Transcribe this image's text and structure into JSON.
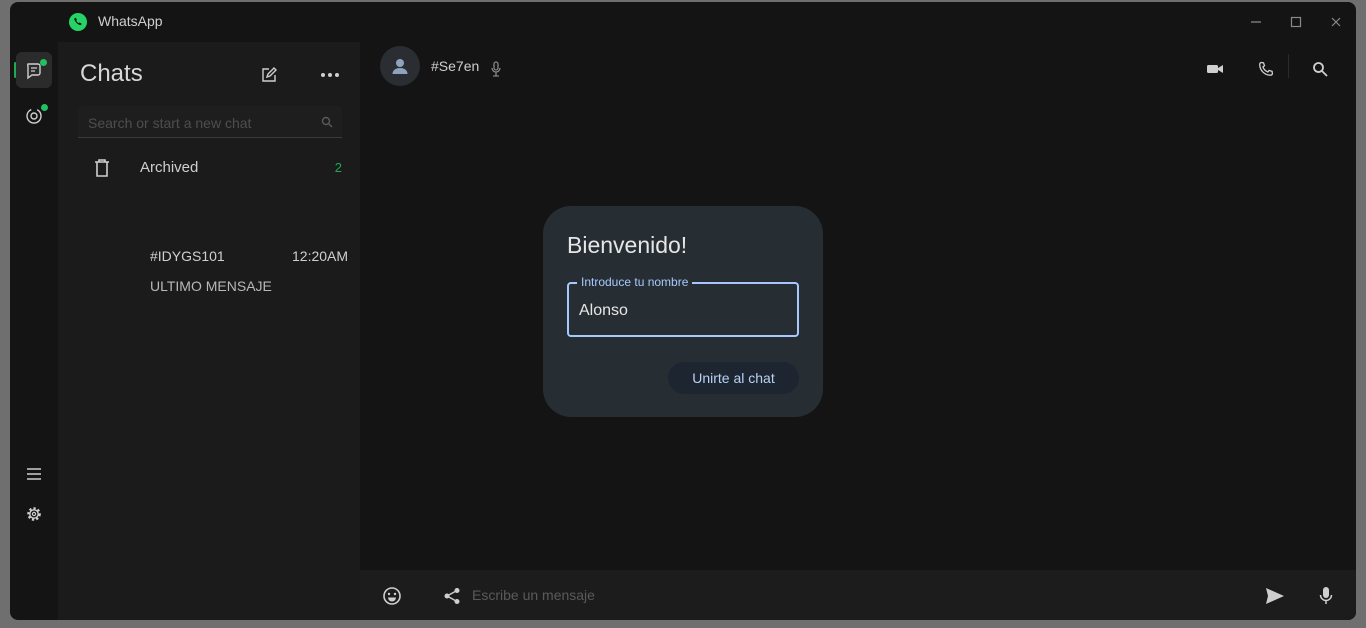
{
  "window": {
    "title": "WhatsApp"
  },
  "sidebar": {
    "title": "Chats",
    "search_placeholder": "Search or start a new chat",
    "archived": {
      "label": "Archived",
      "count": "2"
    },
    "chats": [
      {
        "name": "#IDYGS101",
        "time": "12:20AM",
        "preview": "ULTIMO MENSAJE"
      }
    ]
  },
  "conversation": {
    "contact_name": "#Se7en",
    "composer_placeholder": "Escribe un mensaje"
  },
  "dialog": {
    "title": "Bienvenido!",
    "field_label": "Introduce tu nombre",
    "field_value": "Alonso",
    "button_label": "Unirte al chat"
  },
  "colors": {
    "accent": "#1fa855",
    "dialog_bg": "#272e33",
    "field_border": "#a7c8ff"
  }
}
